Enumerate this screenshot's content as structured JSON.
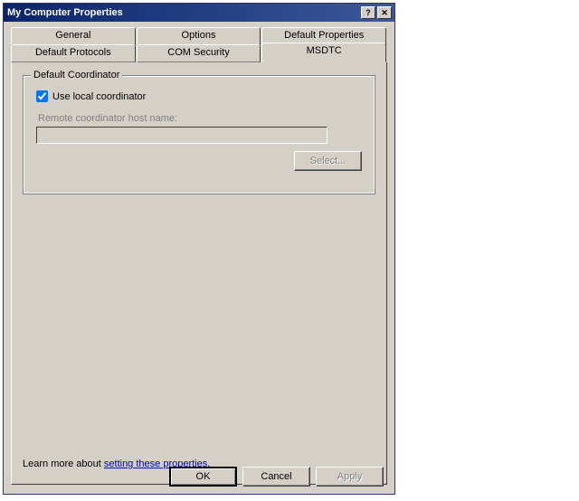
{
  "window": {
    "title": "My Computer Properties"
  },
  "tabs": {
    "row1": [
      "General",
      "Options",
      "Default Properties"
    ],
    "row2": [
      "Default Protocols",
      "COM Security",
      "MSDTC"
    ]
  },
  "panel": {
    "groupbox_title": "Default Coordinator",
    "checkbox_label": "Use local coordinator",
    "checkbox_checked": true,
    "remote_label": "Remote coordinator host name:",
    "remote_value": "",
    "select_button": "Select..."
  },
  "learn_more": {
    "prefix": "Learn more about ",
    "link_text": "setting these properties",
    "suffix": "."
  },
  "buttons": {
    "ok": "OK",
    "cancel": "Cancel",
    "apply": "Apply"
  }
}
